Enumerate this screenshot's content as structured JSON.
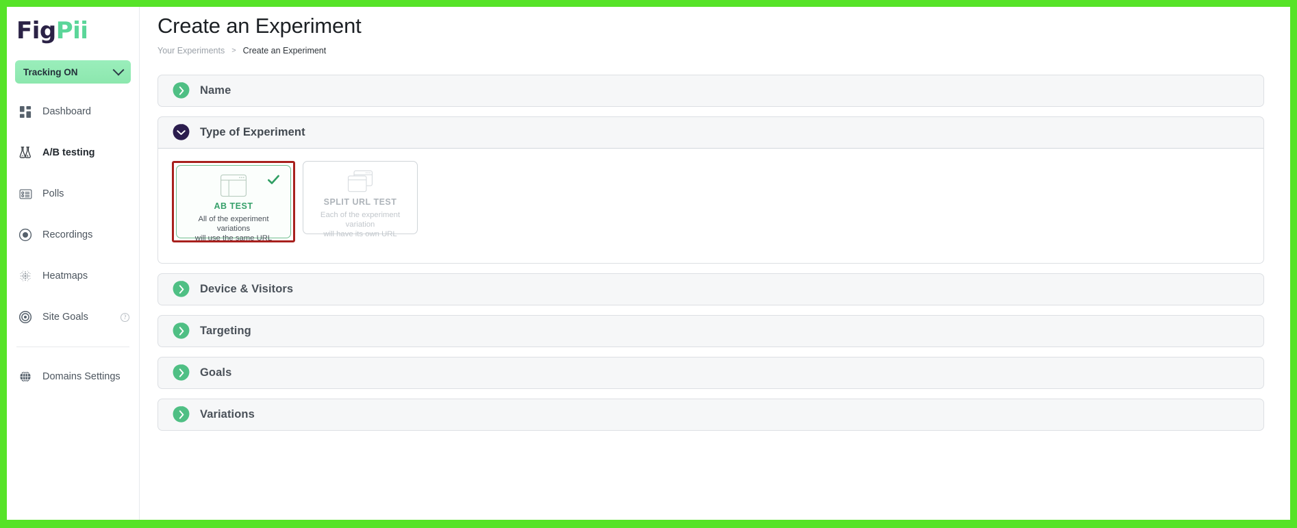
{
  "brand": {
    "logo_first": "Fig",
    "logo_second": "Pii",
    "accent_green": "#5bd699",
    "accent_dark": "#2b2246",
    "frame_green": "#56e328",
    "highlight_red": "#a8201d"
  },
  "sidebar": {
    "tracking": {
      "label": "Tracking ON",
      "icon": "chevron-down-icon"
    },
    "items": [
      {
        "label": "Dashboard",
        "icon": "dashboard-icon",
        "active": false,
        "help": false
      },
      {
        "label": "A/B testing",
        "icon": "flask-ab-icon",
        "active": true,
        "help": false
      },
      {
        "label": "Polls",
        "icon": "poll-list-icon",
        "active": false,
        "help": false
      },
      {
        "label": "Recordings",
        "icon": "record-dot-icon",
        "active": false,
        "help": false
      },
      {
        "label": "Heatmaps",
        "icon": "heatmap-icon",
        "active": false,
        "help": false
      },
      {
        "label": "Site Goals",
        "icon": "target-icon",
        "active": false,
        "help": true,
        "help_glyph": "?"
      }
    ],
    "footer_items": [
      {
        "label": "Domains Settings",
        "icon": "globe-icon"
      }
    ]
  },
  "header": {
    "title": "Create an Experiment",
    "breadcrumb": {
      "parent": "Your Experiments",
      "separator": ">",
      "current": "Create an Experiment"
    }
  },
  "accordion": {
    "sections": [
      {
        "title": "Name",
        "state": "collapsed",
        "badge_icon": "chevron-right-badge-icon"
      },
      {
        "title": "Type of Experiment",
        "state": "expanded",
        "badge_icon": "chevron-down-badge-icon"
      },
      {
        "title": "Device & Visitors",
        "state": "collapsed",
        "badge_icon": "chevron-right-badge-icon"
      },
      {
        "title": "Targeting",
        "state": "collapsed",
        "badge_icon": "chevron-right-badge-icon"
      },
      {
        "title": "Goals",
        "state": "collapsed",
        "badge_icon": "chevron-right-badge-icon"
      },
      {
        "title": "Variations",
        "state": "collapsed",
        "badge_icon": "chevron-right-badge-icon"
      }
    ]
  },
  "experiment_types": {
    "highlighted_card": "ab-test",
    "cards": [
      {
        "id": "ab-test",
        "name": "AB TEST",
        "description_line1": "All of the experiment variations",
        "description_line2": "will use the same URL",
        "selected": true,
        "icon": "browser-window-icon",
        "check_icon": "check-icon"
      },
      {
        "id": "split-url-test",
        "name": "SPLIT URL TEST",
        "description_line1": "Each of the experiment variation",
        "description_line2": "will have its own URL",
        "selected": false,
        "icon": "stacked-windows-icon"
      }
    ]
  }
}
